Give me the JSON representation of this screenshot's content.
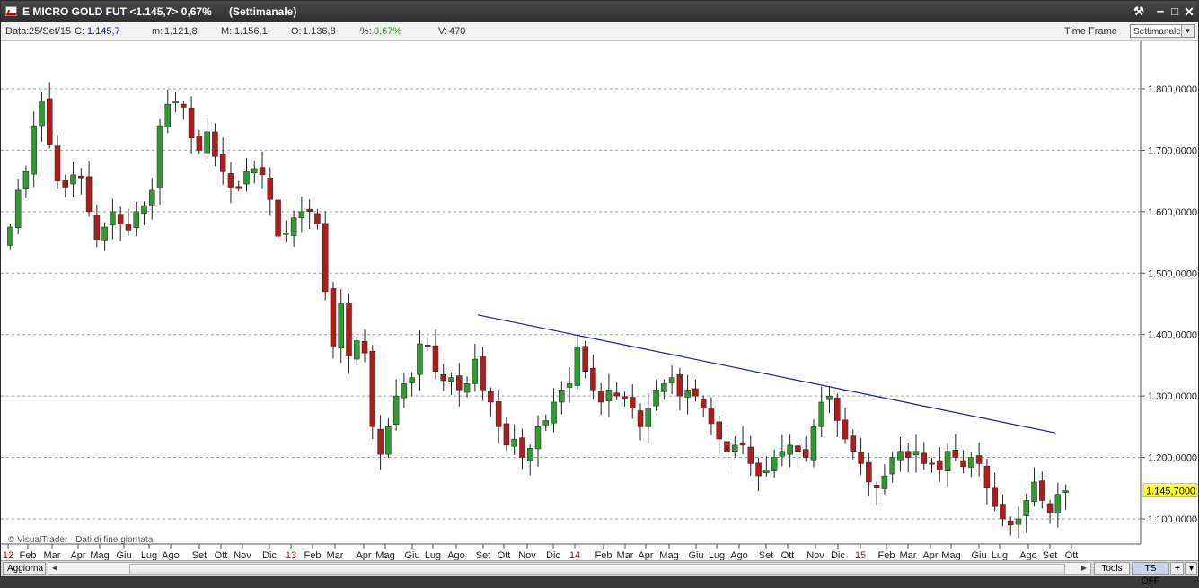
{
  "window": {
    "title": "E MICRO GOLD FUT <1.145,7> 0,67%",
    "period": "(Settimanale)"
  },
  "infobar": {
    "date_label": "Data:",
    "date_value": "25/Set/15",
    "close_label": "C:",
    "close_value": "1.145,7",
    "min_label": "m:",
    "min_value": "1.121,8",
    "max_label": "M:",
    "max_value": "1.156,1",
    "open_label": "O:",
    "open_value": "1.136,8",
    "pct_label": "%:",
    "pct_value": "0,67%",
    "vol_label": "V:",
    "vol_value": "470",
    "timeframe_label": "Time Frame",
    "timeframe_value": "Settimanale"
  },
  "watermark": "© VisualTrader - Dati di fine giornata",
  "bottombar": {
    "update_label": "Aggiorna",
    "tools_label": "Tools",
    "ts_label": "TS OFF",
    "plus_label": "+",
    "menu_label": "▾"
  },
  "colors": {
    "up": "#2f9a2f",
    "down": "#b01c1c",
    "wick": "#222222",
    "trendline": "#1a1a9e",
    "grid": "#a0a0a0",
    "price_tag_bg": "#ffff33",
    "year_label": "#d00000"
  },
  "chart_data": {
    "type": "candlestick",
    "series_name": "E MICRO GOLD FUT",
    "ylim": [
      1070,
      1870
    ],
    "y_ticks": [
      "1.800,0000",
      "1.700,0000",
      "1.600,0000",
      "1.500,0000",
      "1.400,0000",
      "1.300,0000",
      "1.200,0000",
      "1.100,0000"
    ],
    "y_tick_values": [
      1800,
      1700,
      1600,
      1500,
      1400,
      1300,
      1200,
      1100
    ],
    "x_labels": [
      "12",
      "Feb",
      "Mar",
      "Apr",
      "Mag",
      "Giu",
      "Lug",
      "Ago",
      "Set",
      "Ott",
      "Nov",
      "Dic",
      "13",
      "Feb",
      "Mar",
      "Apr",
      "Mag",
      "Giu",
      "Lug",
      "Ago",
      "Set",
      "Ott",
      "Nov",
      "Dic",
      "14",
      "Feb",
      "Mar",
      "Apr",
      "Mag",
      "Giu",
      "Lug",
      "Ago",
      "Set",
      "Ott",
      "Nov",
      "Dic",
      "15",
      "Feb",
      "Mar",
      "Apr",
      "Mag",
      "Giu",
      "Lug",
      "Ago",
      "Set",
      "Ott"
    ],
    "year_labels": [
      "12",
      "13",
      "14",
      "15"
    ],
    "last_price_label": "1.145,7000",
    "last_price": 1145.7,
    "trendline": {
      "from": {
        "week": "Set 2013",
        "value": 1432
      },
      "to": {
        "week": "Set 2015",
        "value": 1240
      }
    },
    "close_path": [
      1575,
      1635,
      1665,
      1740,
      1780,
      1710,
      1650,
      1640,
      1660,
      1655,
      1600,
      1555,
      1575,
      1600,
      1580,
      1570,
      1600,
      1610,
      1635,
      1740,
      1775,
      1780,
      1770,
      1720,
      1700,
      1730,
      1690,
      1665,
      1640,
      1640,
      1665,
      1670,
      1660,
      1620,
      1560,
      1565,
      1590,
      1600,
      1600,
      1580,
      1470,
      1380,
      1450,
      1365,
      1390,
      1370,
      1250,
      1205,
      1250,
      1300,
      1320,
      1330,
      1385,
      1380,
      1340,
      1325,
      1330,
      1310,
      1320,
      1360,
      1310,
      1290,
      1250,
      1220,
      1230,
      1200,
      1215,
      1250,
      1260,
      1290,
      1310,
      1320,
      1380,
      1340,
      1310,
      1290,
      1310,
      1300,
      1295,
      1280,
      1250,
      1280,
      1310,
      1320,
      1330,
      1300,
      1310,
      1300,
      1280,
      1255,
      1230,
      1210,
      1220,
      1220,
      1190,
      1170,
      1180,
      1200,
      1210,
      1220,
      1210,
      1200,
      1250,
      1290,
      1300,
      1260,
      1230,
      1210,
      1190,
      1160,
      1150,
      1170,
      1200,
      1210,
      1200,
      1210,
      1190,
      1190,
      1180,
      1210,
      1200,
      1185,
      1200,
      1190,
      1150,
      1120,
      1100,
      1090,
      1100,
      1130,
      1160,
      1130,
      1110,
      1140,
      1146
    ]
  }
}
